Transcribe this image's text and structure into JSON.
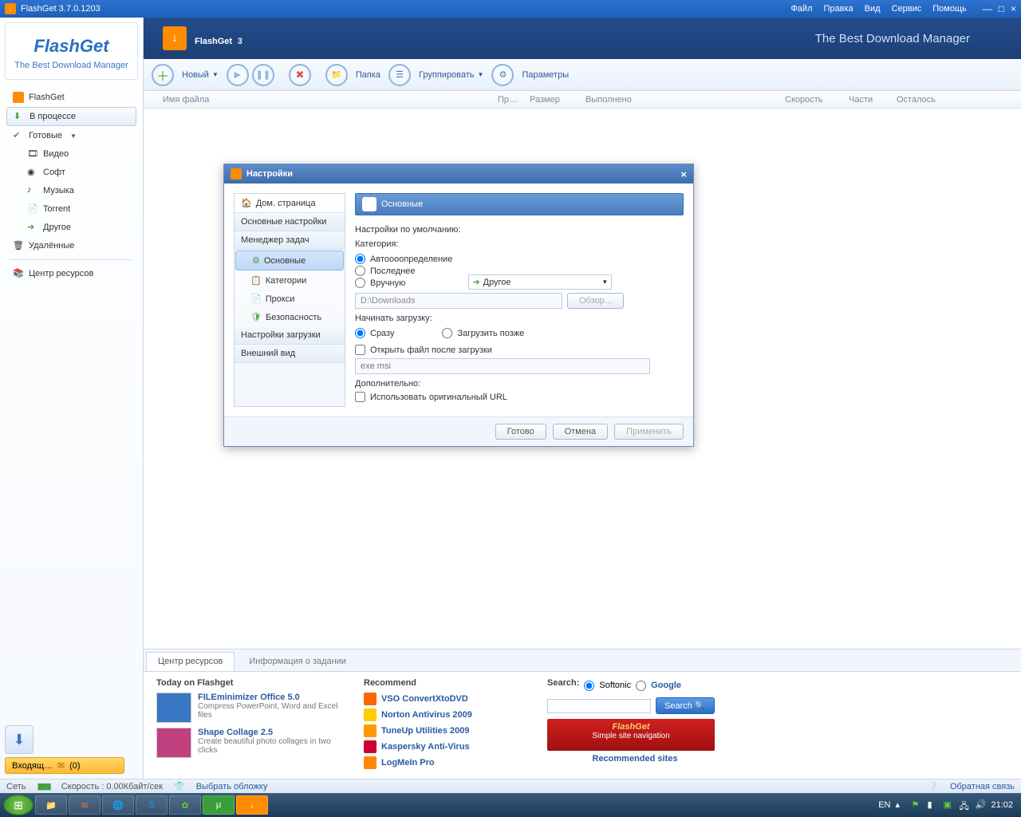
{
  "titlebar": {
    "title": "FlashGet 3.7.0.1203",
    "menu": [
      "Файл",
      "Правка",
      "Вид",
      "Сервис",
      "Помощь"
    ]
  },
  "sidebar": {
    "brand": "FlashGet",
    "tagline": "The Best Download Manager",
    "items": [
      {
        "label": "FlashGet",
        "icon": "flashget"
      },
      {
        "label": "В процессе",
        "icon": "download",
        "selected": true
      },
      {
        "label": "Готовые",
        "icon": "check",
        "expandable": true
      },
      {
        "label": "Видео",
        "icon": "video",
        "sub": true
      },
      {
        "label": "Софт",
        "icon": "soft",
        "sub": true
      },
      {
        "label": "Музыка",
        "icon": "music",
        "sub": true
      },
      {
        "label": "Torrent",
        "icon": "torrent",
        "sub": true
      },
      {
        "label": "Другое",
        "icon": "other",
        "sub": true
      },
      {
        "label": "Удалённые",
        "icon": "trash"
      }
    ],
    "resource_center": "Центр ресурсов",
    "incoming": {
      "label": "Входящ…",
      "count": "(0)"
    }
  },
  "banner": {
    "brand": "FlashGet",
    "version": "3",
    "tagline": "The Best Download Manager"
  },
  "toolbar": {
    "new": "Новый",
    "folder": "Папка",
    "group": "Группировать",
    "params": "Параметры"
  },
  "columns": [
    "Имя файла",
    "Пр…",
    "Размер",
    "Выполнено",
    "Скорость",
    "Части",
    "Осталось"
  ],
  "dialog": {
    "title": "Настройки",
    "nav": {
      "home": "Дом. страница",
      "basic": "Основные настройки",
      "taskmgr": "Менеджер задач",
      "basic_sub": "Основные",
      "categories": "Категории",
      "proxy": "Прокси",
      "security": "Безопасность",
      "download": "Настройки загрузки",
      "appearance": "Внешний вид"
    },
    "section_title": "Основные",
    "defaults_label": "Настройки по умолчанию:",
    "category_label": "Категория:",
    "cat_auto": "Автоооопределение",
    "cat_last": "Последнее",
    "cat_manual": "Вручную",
    "cat_select": "Другое",
    "path": "D:\\Downloads",
    "browse": "Обзор...",
    "start_label": "Начинать загрузку:",
    "start_now": "Сразу",
    "start_later": "Загрузить позже",
    "open_after": "Открыть файл после загрузки",
    "ext_placeholder": "exe msi",
    "extra_label": "Дополнительно:",
    "use_orig_url": "Использовать оригинальный URL",
    "done": "Готово",
    "cancel": "Отмена",
    "apply": "Применить"
  },
  "bottom": {
    "tabs": [
      "Центр ресурсов",
      "Информация о задании"
    ],
    "today_head": "Today on Flashget",
    "today": [
      {
        "title": "FILEminimizer Office 5.0",
        "desc": "Compress PowerPoint, Word and Excel files"
      },
      {
        "title": "Shape Collage 2.5",
        "desc": "Create beautiful photo collages in two clicks"
      }
    ],
    "rec_head": "Recommend",
    "rec": [
      {
        "label": "VSO ConvertXtoDVD",
        "color": "#ff6600"
      },
      {
        "label": "Norton Antivirus 2009",
        "color": "#ffcc00"
      },
      {
        "label": "TuneUp Utilities 2009",
        "color": "#ff9900"
      },
      {
        "label": "Kaspersky Anti-Virus",
        "color": "#cc0033"
      },
      {
        "label": "LogMeIn Pro",
        "color": "#ff8800"
      }
    ],
    "search_head": "Search:",
    "softonic": "Softonic",
    "google": "Google",
    "search_btn": "Search",
    "fg_banner1": "FlashGet",
    "fg_banner2": "Simple site navigation",
    "rec_sites": "Recommended sites"
  },
  "status": {
    "net": "Сеть",
    "net_icons": "::::",
    "speed": "Скорость : 0.00Кбайт/сек",
    "skin": "Выбрать обложку",
    "feedback": "Обратная связь"
  },
  "taskbar": {
    "lang": "EN",
    "clock": "21:02"
  }
}
